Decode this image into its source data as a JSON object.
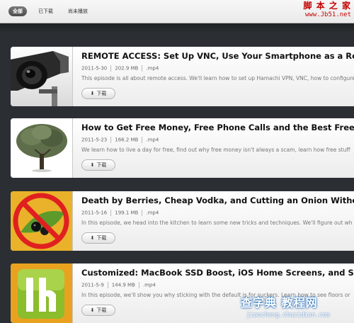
{
  "tabs": [
    {
      "label": "全部",
      "active": true
    },
    {
      "label": "已下载",
      "active": false
    },
    {
      "label": "尚未播放",
      "active": false
    }
  ],
  "watermark_top": {
    "line1": "脚 本 之 家",
    "line2": "www.Jb51.net"
  },
  "watermark_bottom": {
    "line1": "查字典 教程网",
    "line2": "jiaocheng.chazidian.com"
  },
  "download_label": "下载",
  "episodes": [
    {
      "title": "REMOTE ACCESS: Set Up VNC, Use Your Smartphone as a Remote, and",
      "date": "2011-5-30",
      "size": "202.9 MB",
      "format": ".mp4",
      "description": "This episode is all about remote access. We'll learn how to set up Hamachi VPN, VNC, how to configure",
      "thumb_icon": "security-camera-icon"
    },
    {
      "title": "How to Get Free Money, Free Phone Calls and the Best Free Apps! - Li",
      "date": "2011-5-23",
      "size": "166.2 MB",
      "format": ".mp4",
      "description": "We learn how to live a day for free, find out why free money isn't always a scam, learn how free stuff",
      "thumb_icon": "money-tree-icon"
    },
    {
      "title": "Death by Berries, Cheap Vodka, and Cutting an Onion Without Tears -",
      "date": "2011-5-16",
      "size": "199.1 MB",
      "format": ".mp4",
      "description": "In this episode, we head into the kitchen to learn some new tricks and techniques. We'll figure out wh",
      "thumb_icon": "no-berries-icon"
    },
    {
      "title": "Customized: MacBook SSD Boost, iOS Home Screens, and Skipping Flo",
      "date": "2011-5-9",
      "size": "144.9 MB",
      "format": ".mp4",
      "description": "In this episode, we'll show you why sticking with the default is for suckers. Learn how to see floors or",
      "thumb_icon": "lh-logo-icon"
    }
  ]
}
